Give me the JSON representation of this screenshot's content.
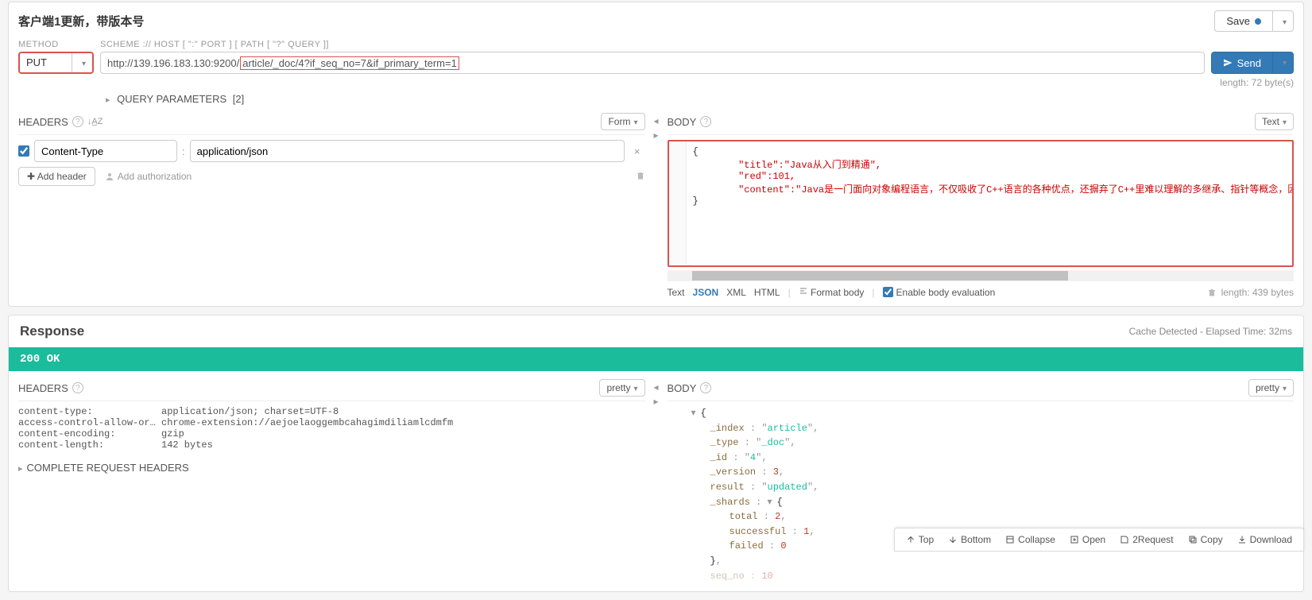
{
  "request": {
    "title": "客户端1更新，带版本号",
    "save_label": "Save",
    "method_label": "METHOD",
    "method_value": "PUT",
    "scheme_label": "SCHEME :// HOST [ \":\" PORT ] [ PATH [ \"?\" QUERY ]]",
    "url_host": "http://139.196.183.130:9200/",
    "url_path": "article/_doc/4?if_seq_no=7&if_primary_term=1",
    "send_label": "Send",
    "length_info": "length: 72 byte(s)",
    "query_params_label": "QUERY PARAMETERS",
    "query_params_count": "[2]"
  },
  "headers": {
    "title": "HEADERS",
    "form_label": "Form",
    "rows": [
      {
        "key": "Content-Type",
        "value": "application/json",
        "checked": true
      }
    ],
    "add_header_label": "Add header",
    "add_auth_label": "Add authorization"
  },
  "body": {
    "title": "BODY",
    "text_label": "Text",
    "code_lines": [
      "{",
      "        \"title\":\"Java从入门到精通\",",
      "        \"red\":101,",
      "        \"content\":\"Java是一门面向对象编程语言，不仅吸收了C++语言的各种优点，还摒弃了C++里难以理解的多继承、指针等概念，因此Java语言具有功能强大和简单易用两",
      "}"
    ],
    "fmt_tabs": {
      "text": "Text",
      "json": "JSON",
      "xml": "XML",
      "html": "HTML"
    },
    "format_body_label": "Format body",
    "enable_eval_label": "Enable body evaluation",
    "length_label": "length: 439 bytes"
  },
  "response": {
    "title": "Response",
    "cache_info": "Cache Detected - Elapsed Time: 32ms",
    "status": "200 OK",
    "headers_title": "HEADERS",
    "pretty_label": "pretty",
    "headers": [
      {
        "k": "content-type:",
        "v": "application/json; charset=UTF-8"
      },
      {
        "k": "access-control-allow-origi…",
        "v": "chrome-extension://aejoelaoggembcahagimdiliamlcdmfm"
      },
      {
        "k": "content-encoding:",
        "v": "gzip"
      },
      {
        "k": "content-length:",
        "v": "142 bytes"
      }
    ],
    "complete_headers_label": "COMPLETE REQUEST HEADERS",
    "body_title": "BODY",
    "json": {
      "_index": "article",
      "_type": "_doc",
      "_id": "4",
      "_version": 3,
      "result": "updated",
      "_shards": {
        "total": 2,
        "successful": 1,
        "failed": 0
      },
      "seq_no_lbl": "seq_no",
      "seq_no_val": "10"
    }
  },
  "bottom": {
    "top": "Top",
    "bottom": "Bottom",
    "collapse": "Collapse",
    "open": "Open",
    "torequest": "2Request",
    "copy": "Copy",
    "download": "Download"
  }
}
